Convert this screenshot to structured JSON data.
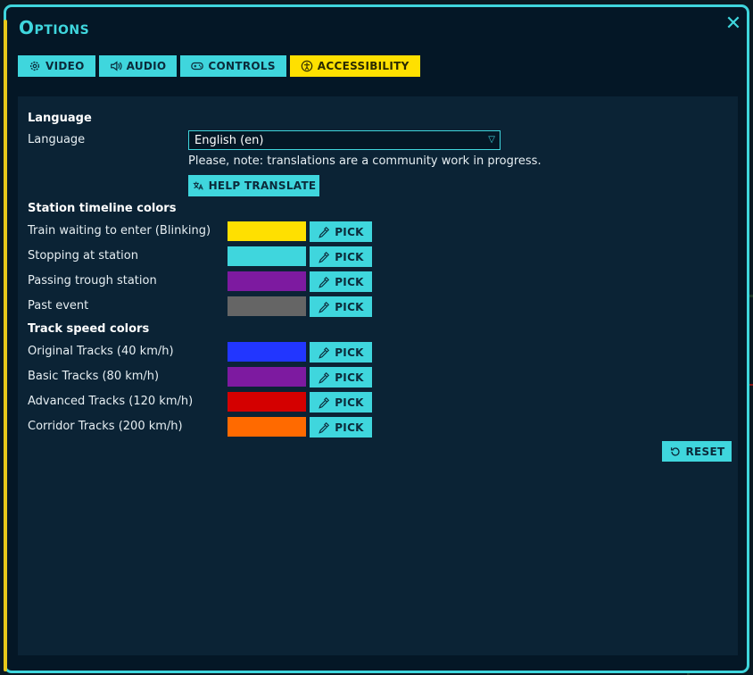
{
  "window": {
    "title": "Options",
    "close_glyph": "✕"
  },
  "tabs": [
    {
      "label": "VIDEO",
      "icon": "gear-icon"
    },
    {
      "label": "AUDIO",
      "icon": "speaker-icon"
    },
    {
      "label": "CONTROLS",
      "icon": "gamepad-icon"
    },
    {
      "label": "ACCESSIBILITY",
      "icon": "accessibility-icon",
      "active": true
    }
  ],
  "language": {
    "section_title": "Language",
    "label": "Language",
    "selected": "English (en)",
    "note": "Please, note: translations are a community work in progress.",
    "help_label": "HELP TRANSLATE"
  },
  "station_colors": {
    "section_title": "Station timeline colors",
    "items": [
      {
        "label": "Train waiting to enter (Blinking)",
        "color": "#ffe000"
      },
      {
        "label": "Stopping at station",
        "color": "#3fd6dd"
      },
      {
        "label": "Passing trough station",
        "color": "#7d1aa0"
      },
      {
        "label": "Past event",
        "color": "#656565"
      }
    ]
  },
  "track_colors": {
    "section_title": "Track speed colors",
    "items": [
      {
        "label": "Original Tracks (40 km/h)",
        "color": "#2236ff"
      },
      {
        "label": "Basic Tracks (80 km/h)",
        "color": "#7d1aa0"
      },
      {
        "label": "Advanced Tracks (120 km/h)",
        "color": "#d40000"
      },
      {
        "label": "Corridor Tracks (200 km/h)",
        "color": "#ff6a00"
      }
    ]
  },
  "pick_label": "PICK",
  "reset_label": "RESET",
  "theme": {
    "accent": "#3fd6dd",
    "active_tab": "#ffe000",
    "panel": "#0b2335"
  }
}
